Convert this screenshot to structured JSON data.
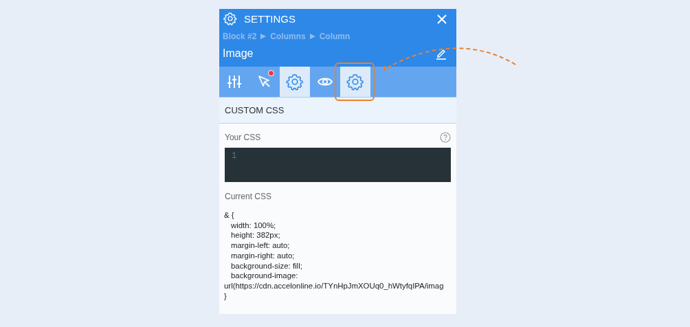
{
  "header": {
    "title": "SETTINGS",
    "breadcrumb": [
      "Block #2",
      "Columns",
      "Column"
    ],
    "element_name": "Image"
  },
  "tabs": [
    {
      "kind": "sliders",
      "selected": false,
      "badge": false,
      "annotated": false
    },
    {
      "kind": "cursor",
      "selected": false,
      "badge": true,
      "annotated": false
    },
    {
      "kind": "gear",
      "selected": true,
      "badge": false,
      "annotated": false
    },
    {
      "kind": "eye",
      "selected": false,
      "badge": false,
      "annotated": false
    },
    {
      "kind": "gear",
      "selected": true,
      "badge": false,
      "annotated": true
    }
  ],
  "section": {
    "title": "CUSTOM CSS"
  },
  "editor": {
    "label": "Your CSS",
    "line_numbers": [
      "1"
    ]
  },
  "current": {
    "label": "Current CSS",
    "lines": [
      {
        "text": "& {",
        "indented": false
      },
      {
        "text": "width: 100%;",
        "indented": true
      },
      {
        "text": "height: 382px;",
        "indented": true
      },
      {
        "text": "margin-left: auto;",
        "indented": true
      },
      {
        "text": "margin-right: auto;",
        "indented": true
      },
      {
        "text": "background-size: fill;",
        "indented": true
      },
      {
        "text": "background-image:",
        "indented": true
      },
      {
        "text": "url(https://cdn.accelonline.io/TYnHpJmXOUq0_hWtyfqIPA/imag",
        "indented": false
      },
      {
        "text": "}",
        "indented": false
      }
    ]
  }
}
